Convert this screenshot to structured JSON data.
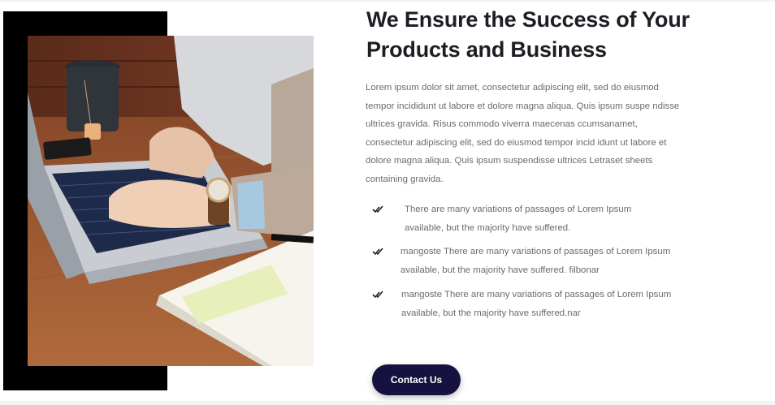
{
  "about": {
    "title": "We Ensure the Success of Your Products and Business",
    "description": "Lorem ipsum dolor sit amet, consectetur adipiscing elit, sed do eiusmod tempor incididunt ut labore et dolore magna aliqua. Quis ipsum suspe ndisse ultrices gravida. Risus commodo viverra maecenas ccumsanamet, consectetur adipiscing elit, sed do eiusmod tempor incid idunt ut labore et dolore magna aliqua. Quis ipsum suspendisse ultrices Letraset sheets containing gravida.",
    "features": [
      {
        "text": "There are many variations of passages of Lorem Ipsum available, but the majority have suffered.",
        "icon": "double-check-icon"
      },
      {
        "text": "mangoste There are many variations of passages of Lorem Ipsum available, but the majority have suffered. filbonar",
        "icon": "double-check-icon"
      },
      {
        "text": "mangoste There are many variations of passages of Lorem Ipsum available, but the majority have suffered.nar",
        "icon": "double-check-icon"
      }
    ],
    "cta_label": "Contact Us"
  },
  "colors": {
    "heading": "#1d1d24",
    "body_text": "#6a6a72",
    "button_bg": "#16123f",
    "accent_block": "#000000"
  }
}
